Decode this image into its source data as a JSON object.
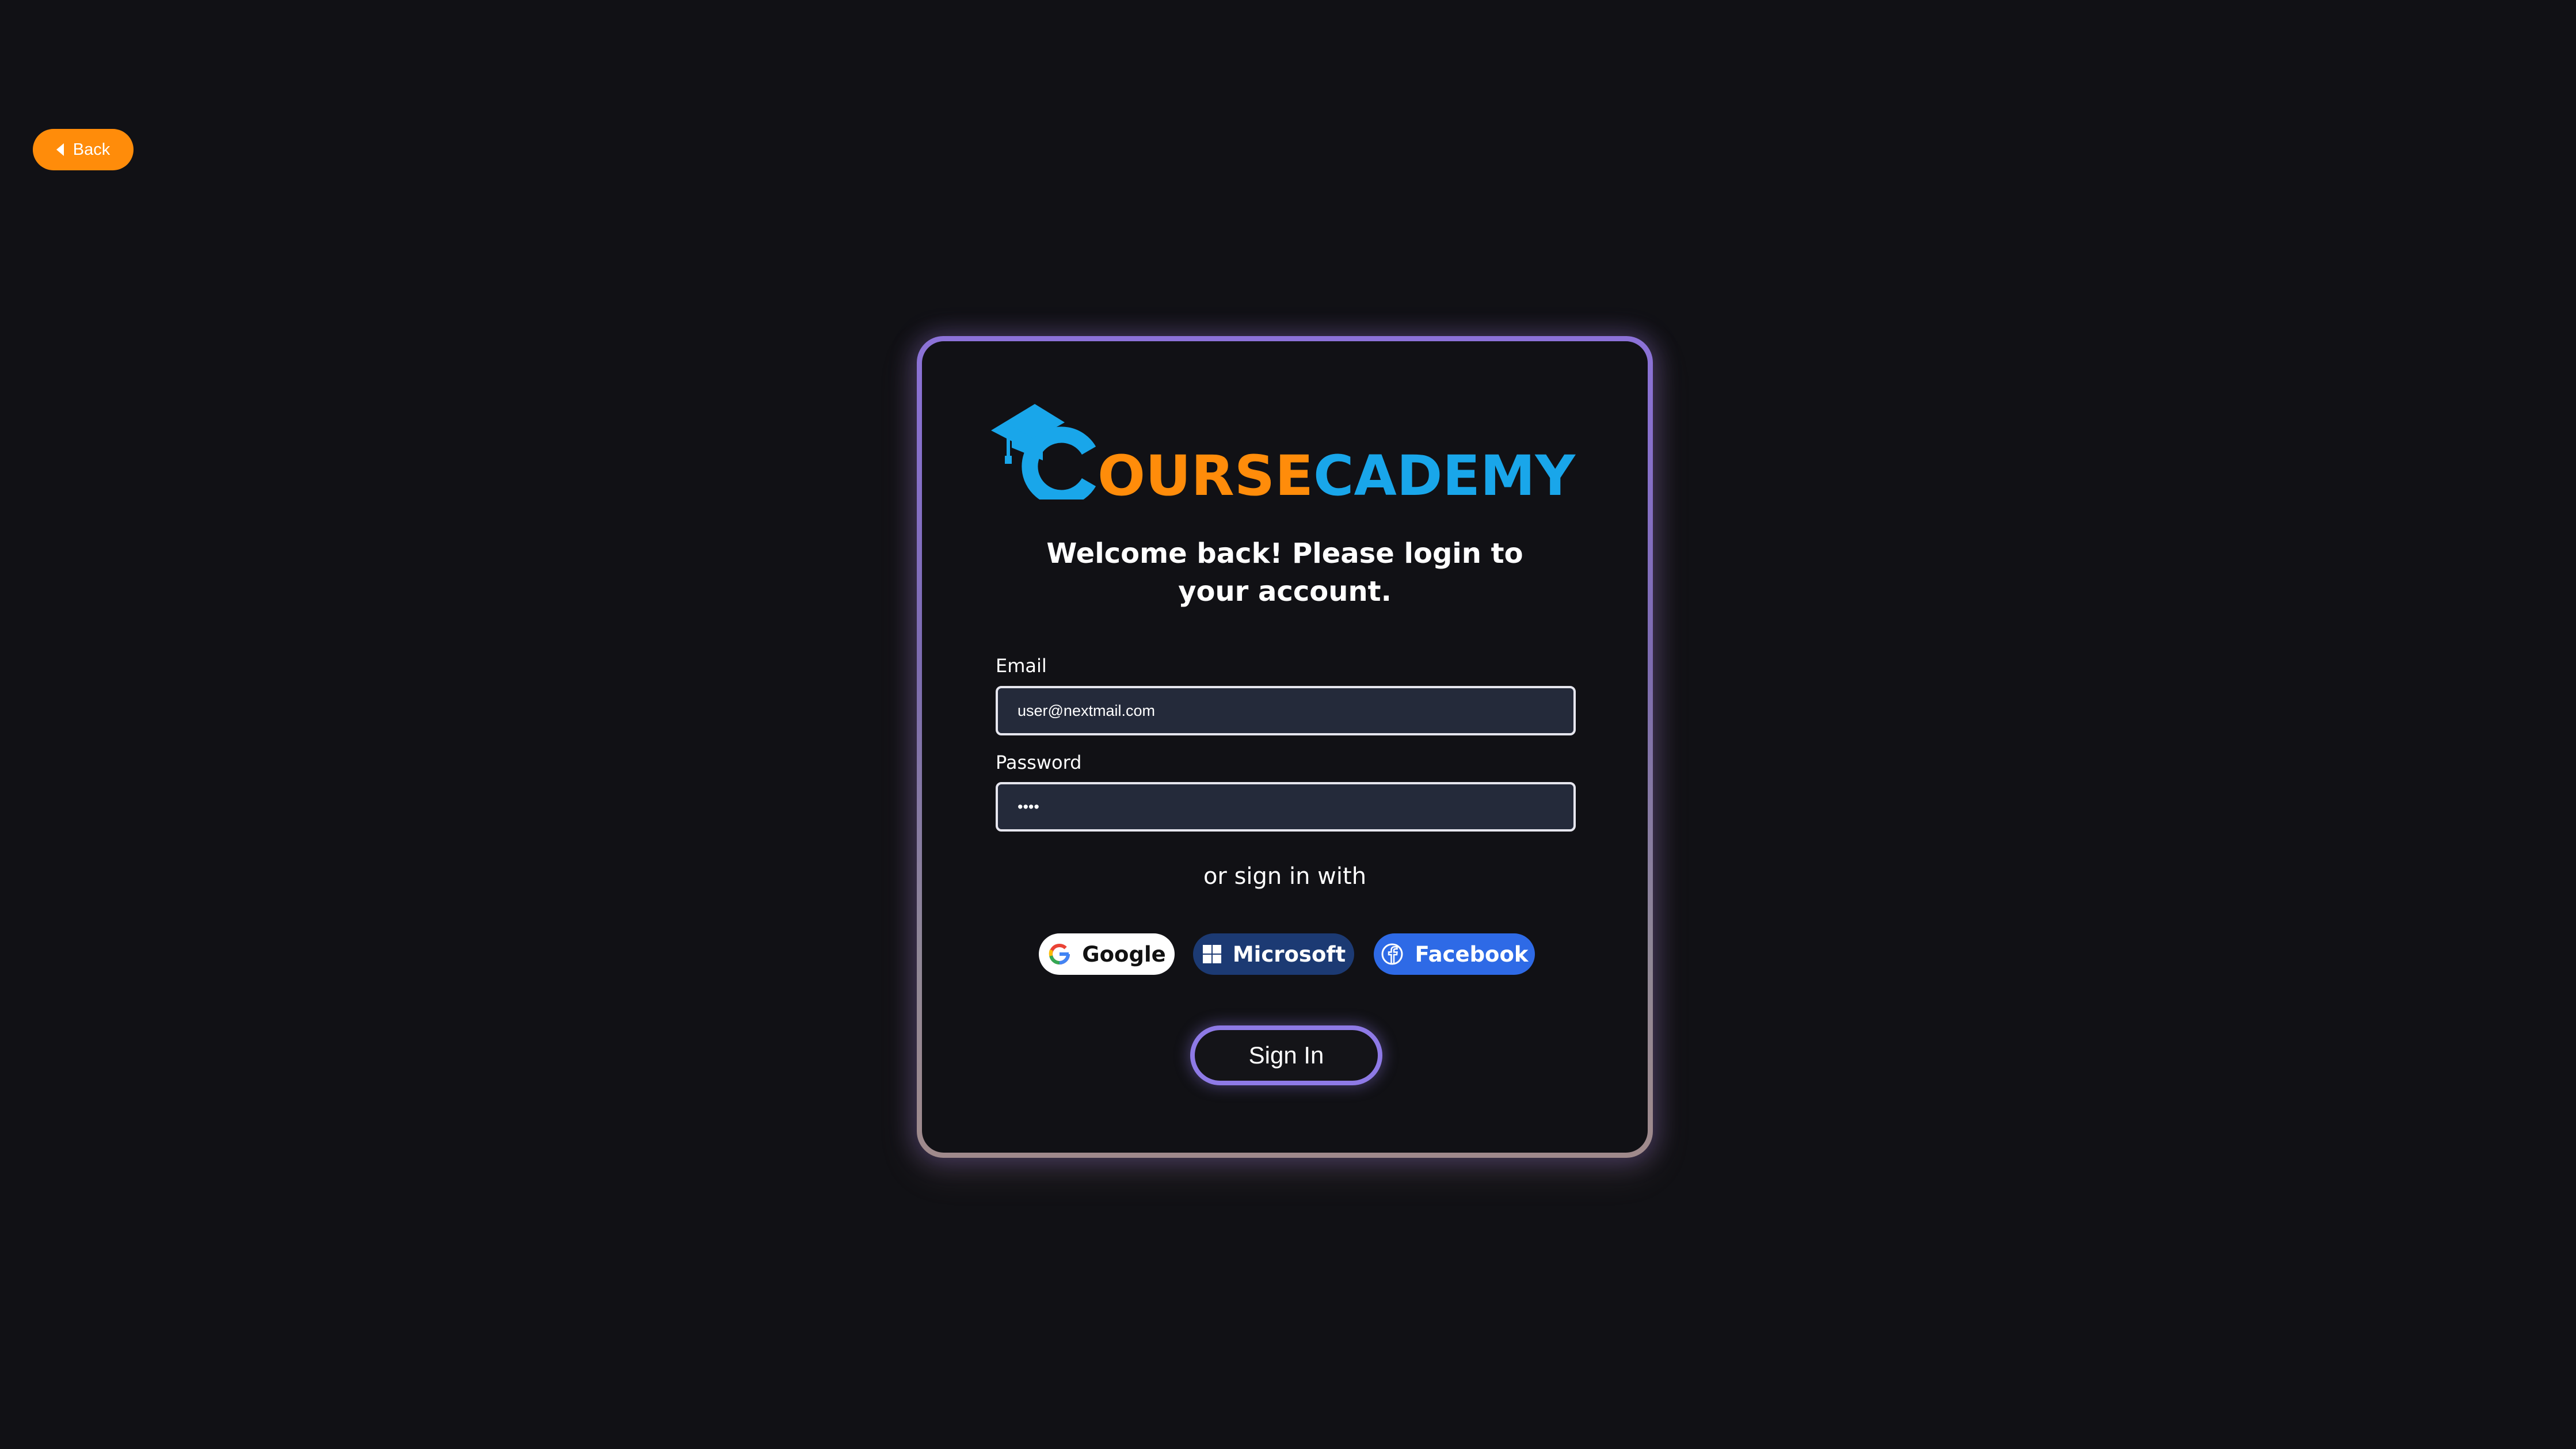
{
  "nav": {
    "back_label": "Back"
  },
  "brand": {
    "logo_text": "COURSECADEMY",
    "colors": {
      "orange": "#ff8c0a",
      "blue": "#19a6ea"
    }
  },
  "login": {
    "heading": "Welcome back! Please login to your account.",
    "email_label": "Email",
    "email_value": "user@nextmail.com",
    "password_label": "Password",
    "password_value": "••••",
    "alt_signin_text": "or sign in with",
    "providers": {
      "google": "Google",
      "microsoft": "Microsoft",
      "facebook": "Facebook"
    },
    "submit_label": "Sign In"
  },
  "theme": {
    "background": "#111115",
    "input_bg": "#242a3a",
    "accent_purple": "#8e7ae6",
    "back_button": "#ff8c0a"
  }
}
